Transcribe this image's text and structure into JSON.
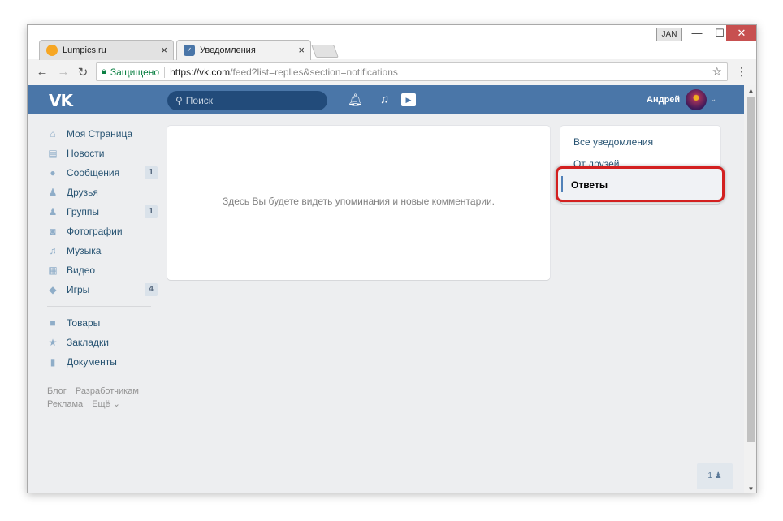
{
  "window": {
    "user_badge": "JAN",
    "min_glyph": "—",
    "max_glyph": "☐",
    "close_glyph": "✕"
  },
  "tabs": [
    {
      "title": "Lumpics.ru",
      "favicon_color": "#f6a623",
      "close": "×"
    },
    {
      "title": "Уведомления",
      "favicon_color": "#4a76a8",
      "close": "×"
    }
  ],
  "address_bar": {
    "secure_label": "Защищено",
    "url_host": "https://vk.com",
    "url_rest": "/feed?list=replies&section=notifications"
  },
  "vk_header": {
    "logo": "VK",
    "search_placeholder": "Поиск",
    "user_name": "Андрей",
    "brand_color": "#4a76a8"
  },
  "sidebar": {
    "items": [
      {
        "label": "Моя Страница",
        "icon": "home-icon",
        "glyph": "⌂",
        "count": null
      },
      {
        "label": "Новости",
        "icon": "news-icon",
        "glyph": "▤",
        "count": null
      },
      {
        "label": "Сообщения",
        "icon": "messages-icon",
        "glyph": "●",
        "count": "1"
      },
      {
        "label": "Друзья",
        "icon": "friends-icon",
        "glyph": "♟",
        "count": null
      },
      {
        "label": "Группы",
        "icon": "groups-icon",
        "glyph": "♟",
        "count": "1"
      },
      {
        "label": "Фотографии",
        "icon": "camera-icon",
        "glyph": "◙",
        "count": null
      },
      {
        "label": "Музыка",
        "icon": "music-icon",
        "glyph": "♫",
        "count": null
      },
      {
        "label": "Видео",
        "icon": "video-icon",
        "glyph": "▦",
        "count": null
      },
      {
        "label": "Игры",
        "icon": "gamepad-icon",
        "glyph": "◆",
        "count": "4"
      }
    ],
    "secondary_items": [
      {
        "label": "Товары",
        "icon": "bag-icon",
        "glyph": "■"
      },
      {
        "label": "Закладки",
        "icon": "star-icon",
        "glyph": "★"
      },
      {
        "label": "Документы",
        "icon": "document-icon",
        "glyph": "▮"
      }
    ],
    "footer": {
      "blog": "Блог",
      "developers": "Разработчикам",
      "ads": "Реклама",
      "more": "Ещё ⌄"
    }
  },
  "main": {
    "empty_text": "Здесь Вы будете видеть упоминания и новые комментарии."
  },
  "right_menu": {
    "all": "Все уведомления",
    "friends": "От друзей",
    "replies": "Ответы"
  },
  "chat": {
    "count": "1"
  }
}
